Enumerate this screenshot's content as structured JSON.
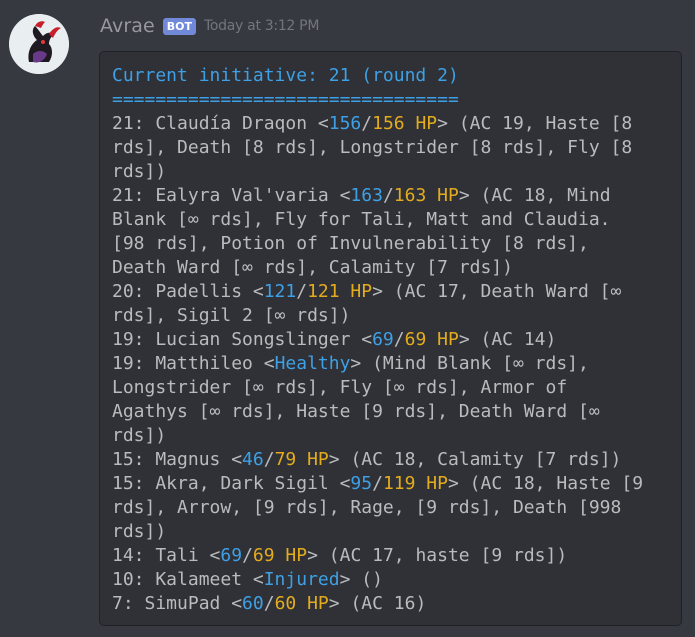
{
  "message": {
    "username": "Avrae",
    "bot_tag": "BOT",
    "timestamp": "Today at 3:12 PM"
  },
  "colors": {
    "background": "#36393f",
    "codeblock_background": "#2f3136",
    "username": "#96989d",
    "bot_tag": "#7289da",
    "hp_blue": "#3ea0e6",
    "hp_gold": "#e4ac1d",
    "text": "#b9bbbe"
  },
  "initiative": {
    "header": "Current initiative: 21 (round 2)",
    "separator": "================================",
    "lines": [
      [
        {
          "t": "21: Claudía Draqon <"
        },
        {
          "t": "156",
          "c": "blue"
        },
        {
          "t": "/"
        },
        {
          "t": "156 HP",
          "c": "gold"
        },
        {
          "t": "> (AC 19, Haste [8"
        }
      ],
      [
        {
          "t": "rds], Death [8 rds], Longstrider [8 rds], Fly [8"
        }
      ],
      [
        {
          "t": "rds])"
        }
      ],
      [
        {
          "t": "21: Ealyra Val'varia <"
        },
        {
          "t": "163",
          "c": "blue"
        },
        {
          "t": "/"
        },
        {
          "t": "163 HP",
          "c": "gold"
        },
        {
          "t": "> (AC 18, Mind"
        }
      ],
      [
        {
          "t": "Blank [∞ rds], Fly for Tali, Matt and Claudia."
        }
      ],
      [
        {
          "t": "[98 rds], Potion of Invulnerability [8 rds],"
        }
      ],
      [
        {
          "t": "Death Ward [∞ rds], Calamity [7 rds])"
        }
      ],
      [
        {
          "t": "20: Padellis <"
        },
        {
          "t": "121",
          "c": "blue"
        },
        {
          "t": "/"
        },
        {
          "t": "121 HP",
          "c": "gold"
        },
        {
          "t": "> (AC 17, Death Ward [∞"
        }
      ],
      [
        {
          "t": "rds], Sigil 2 [∞ rds])"
        }
      ],
      [
        {
          "t": "19: Lucian Songslinger <"
        },
        {
          "t": "69",
          "c": "blue"
        },
        {
          "t": "/"
        },
        {
          "t": "69 HP",
          "c": "gold"
        },
        {
          "t": "> (AC 14)"
        }
      ],
      [
        {
          "t": "19: Matthileo <"
        },
        {
          "t": "Healthy",
          "c": "blue"
        },
        {
          "t": "> (Mind Blank [∞ rds],"
        }
      ],
      [
        {
          "t": "Longstrider [∞ rds], Fly [∞ rds], Armor of"
        }
      ],
      [
        {
          "t": "Agathys [∞ rds], Haste [9 rds], Death Ward [∞"
        }
      ],
      [
        {
          "t": "rds])"
        }
      ],
      [
        {
          "t": "15: Magnus <"
        },
        {
          "t": "46",
          "c": "blue"
        },
        {
          "t": "/"
        },
        {
          "t": "79 HP",
          "c": "gold"
        },
        {
          "t": "> (AC 18, Calamity [7 rds])"
        }
      ],
      [
        {
          "t": "15: Akra, Dark Sigil <"
        },
        {
          "t": "95",
          "c": "blue"
        },
        {
          "t": "/"
        },
        {
          "t": "119 HP",
          "c": "gold"
        },
        {
          "t": "> (AC 18, Haste [9"
        }
      ],
      [
        {
          "t": "rds], Arrow, [9 rds], Rage, [9 rds], Death [998"
        }
      ],
      [
        {
          "t": "rds])"
        }
      ],
      [
        {
          "t": "14: Tali <"
        },
        {
          "t": "69",
          "c": "blue"
        },
        {
          "t": "/"
        },
        {
          "t": "69 HP",
          "c": "gold"
        },
        {
          "t": "> (AC 17, haste [9 rds])"
        }
      ],
      [
        {
          "t": "10: Kalameet <"
        },
        {
          "t": "Injured",
          "c": "blue"
        },
        {
          "t": "> ()"
        }
      ],
      [
        {
          "t": "7: SimuPad <"
        },
        {
          "t": "60",
          "c": "blue"
        },
        {
          "t": "/"
        },
        {
          "t": "60 HP",
          "c": "gold"
        },
        {
          "t": "> (AC 16)"
        }
      ]
    ]
  }
}
